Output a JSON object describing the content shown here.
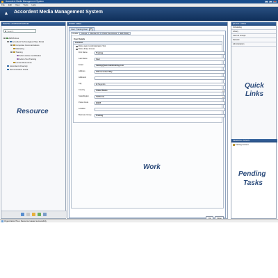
{
  "window": {
    "title": "Accordent Media Management System"
  },
  "menu": [
    "File",
    "Edit",
    "View",
    "Tools",
    "Help"
  ],
  "banner": {
    "app_name": "Accordent Media Management System"
  },
  "left": {
    "title": "PORTAL ADMINISTRATION",
    "search_placeholder": "Search",
    "tree": [
      {
        "label": "ARMS Root"
      },
      {
        "label": "Accordent Technologies Video Portal"
      },
      {
        "label": "Corporate Communications"
      },
      {
        "label": "Marketing"
      },
      {
        "label": "Training"
      },
      {
        "label": "Admin Active Certification"
      },
      {
        "label": "Admin Tool Training"
      },
      {
        "label": "Human Resources"
      },
      {
        "label": "Accordent University"
      },
      {
        "label": "Demonstration Portal"
      }
    ],
    "overlay": "Resource"
  },
  "work": {
    "title": "WORK AREA",
    "tab_label": "User: Training User",
    "subtabs": [
      "Details",
      "Groups",
      "Member Of",
      "Portal Tree Access",
      "Edit History"
    ],
    "section_title": "User Details",
    "common_title": "Common",
    "checkboxes": [
      "Allow Logon to Administration Tool",
      "Allow Library Access"
    ],
    "fields": [
      {
        "label": "First Name",
        "value": "Training"
      },
      {
        "label": "Last Name",
        "value": "User"
      },
      {
        "label": "Email",
        "value": "training@accordenttraining.com"
      },
      {
        "label": "Address",
        "value": "123 Accordent Way"
      },
      {
        "label": "Address2",
        "value": ""
      },
      {
        "label": "City",
        "value": "El Segundo"
      },
      {
        "label": "Country",
        "value": "United States"
      },
      {
        "label": "State/Region",
        "value": "California"
      },
      {
        "label": "Postal Code",
        "value": "90245"
      },
      {
        "label": "Location",
        "value": ""
      },
      {
        "label": "Business Group",
        "value": "Training"
      }
    ],
    "buttons": {
      "ok": "Ok",
      "close": "Close"
    },
    "overlay": "Work"
  },
  "right": {
    "quick_title": "QUICK LINKS",
    "quick_links": [
      "Scheduling",
      "Library",
      "Users & Groups",
      "Network",
      "Administration"
    ],
    "quick_overlay_1": "Quick",
    "quick_overlay_2": "Links",
    "pending_title": "PENDING TASKS",
    "pending_items": [
      "Training Content"
    ],
    "pending_overlay_1": "Pending",
    "pending_overlay_2": "Tasks"
  },
  "status": {
    "text": "Organization/Tree: Resource loaded successfully"
  }
}
